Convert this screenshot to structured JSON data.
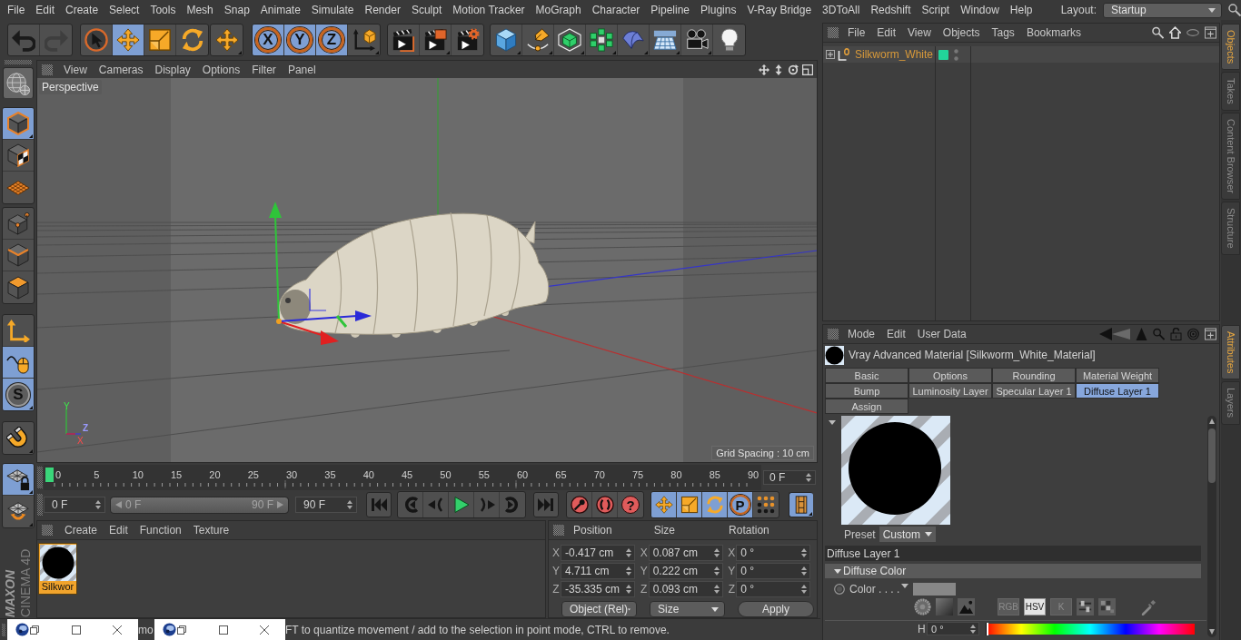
{
  "menu_bar": {
    "items": [
      "File",
      "Edit",
      "Create",
      "Select",
      "Tools",
      "Mesh",
      "Snap",
      "Animate",
      "Simulate",
      "Render",
      "Sculpt",
      "Motion Tracker",
      "MoGraph",
      "Character",
      "Pipeline",
      "Plugins",
      "V-Ray Bridge",
      "3DToAll",
      "Redshift",
      "Script",
      "Window",
      "Help"
    ],
    "layout_label": "Layout:",
    "layout_value": "Startup"
  },
  "toolbar": {
    "history": [
      {
        "disabled": false
      },
      {
        "disabled": true
      }
    ],
    "tools": [
      {
        "selected": false
      },
      {
        "selected": true
      },
      {
        "selected": false
      },
      {
        "selected": false
      },
      {
        "selected": false
      }
    ],
    "axes": [
      {
        "label": "X",
        "selected": true
      },
      {
        "label": "Y",
        "selected": true
      },
      {
        "label": "Z",
        "selected": true
      }
    ]
  },
  "left_toolbar": [
    {
      "selected": true
    },
    {
      "selected": false
    },
    {
      "selected": false
    },
    {
      "selected": false
    },
    {
      "selected": false
    },
    {
      "selected": false
    },
    {
      "selected": false
    },
    {
      "selected": true
    },
    {
      "selected": true,
      "glyph": "S"
    },
    {
      "selected": false
    },
    {
      "selected": true
    },
    {
      "selected": false
    }
  ],
  "logo": {
    "brand": "MAXON",
    "product": "CINEMA 4D"
  },
  "viewport": {
    "menu": [
      "View",
      "Cameras",
      "Display",
      "Options",
      "Filter",
      "Panel"
    ],
    "camera": "Perspective",
    "grid_spacing": "Grid Spacing : 10 cm",
    "axis_labels": [
      "Y",
      "Z",
      "X"
    ]
  },
  "timeline": {
    "ticks": [
      "0",
      "5",
      "10",
      "15",
      "20",
      "25",
      "30",
      "35",
      "40",
      "45",
      "50",
      "55",
      "60",
      "65",
      "70",
      "75",
      "80",
      "85",
      "90"
    ],
    "playhead": {
      "level": 0
    },
    "current_frame": "0 F"
  },
  "transport": {
    "start_field": "0 F",
    "range": {
      "start": "0 F",
      "end": "90 F",
      "level": 1
    },
    "end_field": "90 F",
    "selection_glyph": "?",
    "key_modes": [
      {
        "selected": true
      },
      {
        "selected": true
      },
      {
        "selected": true
      },
      {
        "selected": true,
        "glyph": "P"
      },
      {
        "selected": false
      }
    ],
    "timeline_toggle": {
      "selected": true
    }
  },
  "material_manager": {
    "menu": [
      "Create",
      "Edit",
      "Function",
      "Texture"
    ],
    "materials": [
      {
        "name": "Silkwor",
        "selected": true
      }
    ]
  },
  "coordinates": {
    "columns": [
      {
        "header": "Position",
        "fields": [
          {
            "axis": "X",
            "value": "-0.417 cm"
          },
          {
            "axis": "Y",
            "value": "4.711 cm"
          },
          {
            "axis": "Z",
            "value": "-35.335 cm"
          }
        ]
      },
      {
        "header": "Size",
        "fields": [
          {
            "axis": "X",
            "value": "0.087 cm"
          },
          {
            "axis": "Y",
            "value": "0.222 cm"
          },
          {
            "axis": "Z",
            "value": "0.093 cm"
          }
        ]
      },
      {
        "header": "Rotation",
        "fields": [
          {
            "axis": "X",
            "value": "0 °"
          },
          {
            "axis": "Y",
            "value": "0 °"
          },
          {
            "axis": "Z",
            "value": "0 °"
          }
        ]
      }
    ],
    "mode": "Object (Rel)",
    "size_mode": "Size",
    "apply": "Apply"
  },
  "status_bar": {
    "fragments": [
      "mo",
      "FT to quantize movement / add to the selection in point mode, CTRL to remove."
    ]
  },
  "object_manager": {
    "menu": [
      "File",
      "Edit",
      "View",
      "Objects",
      "Tags",
      "Bookmarks"
    ],
    "objects": [
      {
        "name": "Silkworm_White",
        "expanded": false,
        "selected": true,
        "color": "#22d49a"
      }
    ]
  },
  "side_tabs": {
    "upper": [
      {
        "label": "Objects",
        "selected": true
      },
      {
        "label": "Takes",
        "selected": false
      },
      {
        "label": "Content Browser",
        "selected": false
      },
      {
        "label": "Structure",
        "selected": false
      }
    ],
    "lower": [
      {
        "label": "Attributes",
        "selected": true
      },
      {
        "label": "Layers",
        "selected": false
      }
    ]
  },
  "attribute_manager": {
    "menu": [
      "Mode",
      "Edit",
      "User Data"
    ],
    "title": "Vray Advanced Material [Silkworm_White_Material]",
    "tabs": [
      {
        "label": "Basic",
        "selected": false
      },
      {
        "label": "Options",
        "selected": false
      },
      {
        "label": "Rounding",
        "selected": false
      },
      {
        "label": "Material Weight",
        "selected": false
      },
      {
        "label": "Bump",
        "selected": false
      },
      {
        "label": "Luminosity Layer",
        "selected": false
      },
      {
        "label": "Specular Layer 1",
        "selected": false
      },
      {
        "label": "Diffuse Layer 1",
        "selected": true
      },
      {
        "label": "Assign",
        "selected": false
      }
    ],
    "preset_label": "Preset",
    "preset_value": "Custom",
    "section": "Diffuse Layer 1",
    "group": {
      "title": "Diffuse Color",
      "expanded": true
    },
    "color_param": {
      "label": "Color . . . .",
      "color": "#878787"
    },
    "color_modes": [
      {
        "label": "RGB",
        "selected": false
      },
      {
        "label": "HSV",
        "selected": true
      },
      {
        "label": "K",
        "selected": false
      }
    ],
    "hue": {
      "label": "H",
      "value": "0 °",
      "level": 0
    }
  }
}
